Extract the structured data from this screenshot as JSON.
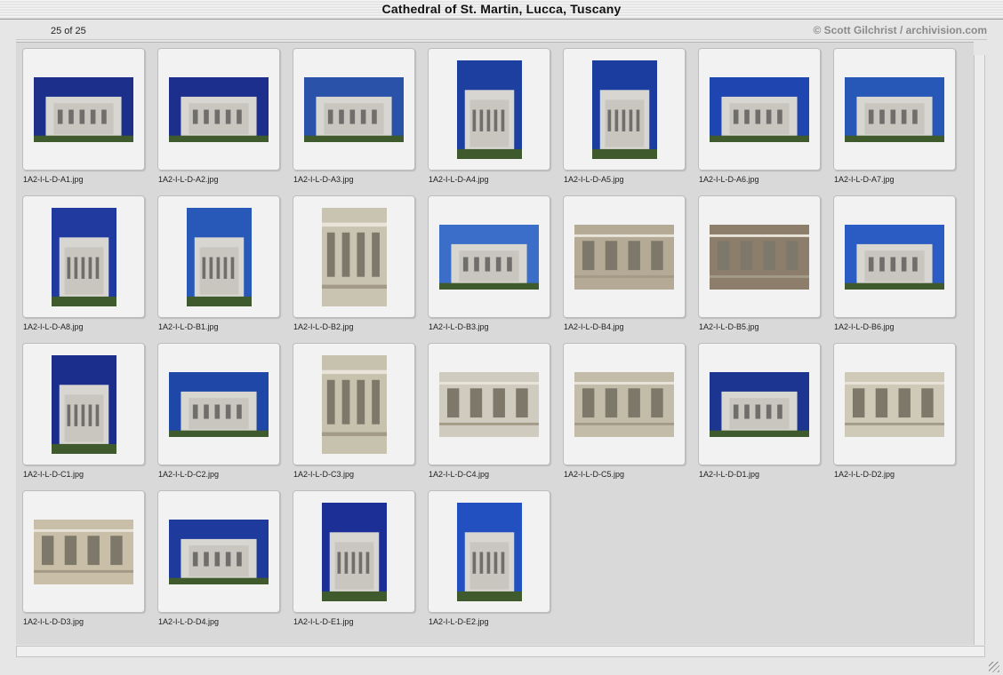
{
  "window": {
    "title": "Cathedral of St. Martin, Lucca, Tuscany",
    "count": "25 of 25",
    "credit": "© Scott Gilchrist / archivision.com"
  },
  "thumbnails": [
    {
      "label": "1A2-I-L-D-A1.jpg",
      "orientation": "landscape",
      "sky": "#1c2f8a"
    },
    {
      "label": "1A2-I-L-D-A2.jpg",
      "orientation": "landscape",
      "sky": "#1d2f8d"
    },
    {
      "label": "1A2-I-L-D-A3.jpg",
      "orientation": "landscape",
      "sky": "#2a52a8"
    },
    {
      "label": "1A2-I-L-D-A4.jpg",
      "orientation": "portrait",
      "sky": "#1d3fa0"
    },
    {
      "label": "1A2-I-L-D-A5.jpg",
      "orientation": "portrait",
      "sky": "#1b3da0"
    },
    {
      "label": "1A2-I-L-D-A6.jpg",
      "orientation": "landscape",
      "sky": "#1f45b0"
    },
    {
      "label": "1A2-I-L-D-A7.jpg",
      "orientation": "landscape",
      "sky": "#2758b8"
    },
    {
      "label": "1A2-I-L-D-A8.jpg",
      "orientation": "portrait",
      "sky": "#203aa0"
    },
    {
      "label": "1A2-I-L-D-B1.jpg",
      "orientation": "portrait",
      "sky": "#2858b8"
    },
    {
      "label": "1A2-I-L-D-B2.jpg",
      "orientation": "portrait",
      "sky": "#c9c4b2"
    },
    {
      "label": "1A2-I-L-D-B3.jpg",
      "orientation": "landscape",
      "sky": "#3a6ec8"
    },
    {
      "label": "1A2-I-L-D-B4.jpg",
      "orientation": "landscape",
      "sky": "#b5aa95"
    },
    {
      "label": "1A2-I-L-D-B5.jpg",
      "orientation": "landscape",
      "sky": "#8c7e6a"
    },
    {
      "label": "1A2-I-L-D-B6.jpg",
      "orientation": "landscape",
      "sky": "#2a5cc4"
    },
    {
      "label": "1A2-I-L-D-C1.jpg",
      "orientation": "portrait",
      "sky": "#1c2e8c"
    },
    {
      "label": "1A2-I-L-D-C2.jpg",
      "orientation": "landscape",
      "sky": "#1e47a8"
    },
    {
      "label": "1A2-I-L-D-C3.jpg",
      "orientation": "portrait",
      "sky": "#c6c2ad"
    },
    {
      "label": "1A2-I-L-D-C4.jpg",
      "orientation": "landscape",
      "sky": "#cfcbbf"
    },
    {
      "label": "1A2-I-L-D-C5.jpg",
      "orientation": "landscape",
      "sky": "#c2bca9"
    },
    {
      "label": "1A2-I-L-D-D1.jpg",
      "orientation": "landscape",
      "sky": "#1c3590"
    },
    {
      "label": "1A2-I-L-D-D2.jpg",
      "orientation": "landscape",
      "sky": "#cfc9b7"
    },
    {
      "label": "1A2-I-L-D-D3.jpg",
      "orientation": "landscape",
      "sky": "#c9bfa8"
    },
    {
      "label": "1A2-I-L-D-D4.jpg",
      "orientation": "landscape",
      "sky": "#1d3a9c"
    },
    {
      "label": "1A2-I-L-D-E1.jpg",
      "orientation": "portrait",
      "sky": "#1b2f96"
    },
    {
      "label": "1A2-I-L-D-E2.jpg",
      "orientation": "portrait",
      "sky": "#2350c0"
    }
  ]
}
